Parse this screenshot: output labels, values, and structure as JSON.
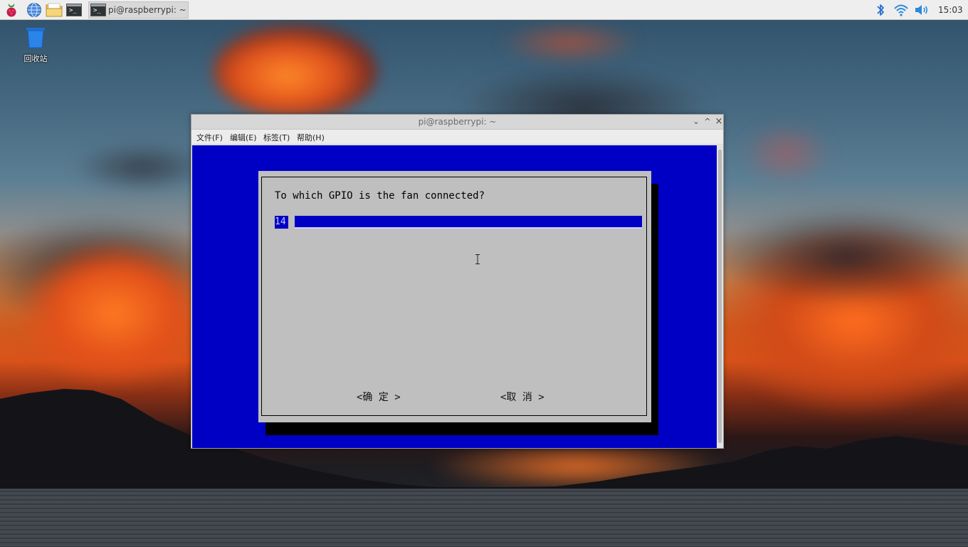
{
  "taskbar": {
    "task_label": "pi@raspberrypi: ~",
    "clock": "15:03"
  },
  "desktop": {
    "trash_label": "回收站"
  },
  "window": {
    "title": "pi@raspberrypi: ~",
    "menu": [
      "文件(F)",
      "编辑(E)",
      "标签(T)",
      "帮助(H)"
    ],
    "controls": {
      "minimize": "⌄",
      "maximize": "^",
      "close": "×"
    }
  },
  "dialog": {
    "prompt": "To which GPIO is the fan connected?",
    "input_value": "14",
    "ok_label": "<确 定 >",
    "cancel_label": "<取 消 >"
  },
  "colors": {
    "terminal_bg": "#0000c4",
    "dialog_bg": "#bfbfbf",
    "taskbar_bg": "#eeeeee"
  },
  "icons": [
    "raspberry-menu-icon",
    "browser-globe-icon",
    "file-manager-icon",
    "terminal-icon",
    "bluetooth-icon",
    "wifi-icon",
    "volume-icon",
    "trash-icon"
  ]
}
